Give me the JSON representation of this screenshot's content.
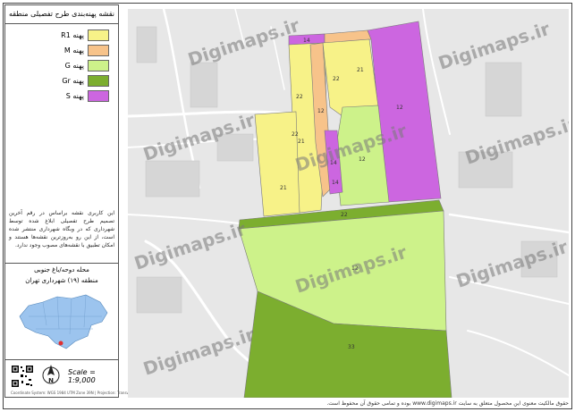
{
  "title": "نقشه پهنه‌بندی طرح تفصیلی منطقه",
  "legend": [
    {
      "code": "R1",
      "label": "پهنه R1",
      "color": "#f7f288"
    },
    {
      "code": "M",
      "label": "پهنه M",
      "color": "#f7c38a"
    },
    {
      "code": "G",
      "label": "پهنه G",
      "color": "#cdf28a"
    },
    {
      "code": "Gr",
      "label": "پهنه Gr",
      "color": "#7cae2f"
    },
    {
      "code": "S",
      "label": "پهنه S",
      "color": "#cc66e0"
    }
  ],
  "description": "این کاربری نقشه براساس در رقم آخرین تصمیم طرح تفصیلی ابلاغ شده توسط شهرداری که در وبگاه شهرداری منتشر شده است، از این رو به‌روزترین نقشه‌ها هستند و امکان تطبیق با نقشه‌های مصوب وجود ندارد.",
  "location": {
    "title": "محله دوحه/باغ جنوبی",
    "subtitle": "منطقه (۱۹) شهرداری تهران"
  },
  "scale": "Scale = 1:9,000",
  "north_label": "N",
  "footer_small": "Coordinate System: WGS 1984 UTM Zone 39N | Projection: Transverse Mercator",
  "credit": "حقوق مالکیت معنوی این محصول متعلق به سایت www.digimaps.ir بوده و تمامی حقوق آن محفوظ است.",
  "watermark": "Digimaps.ir",
  "zone_labels": [
    "14",
    "22",
    "21",
    "22",
    "12",
    "21",
    "22",
    "21",
    "12",
    "14",
    "14",
    "12",
    "22",
    "12",
    "33"
  ]
}
